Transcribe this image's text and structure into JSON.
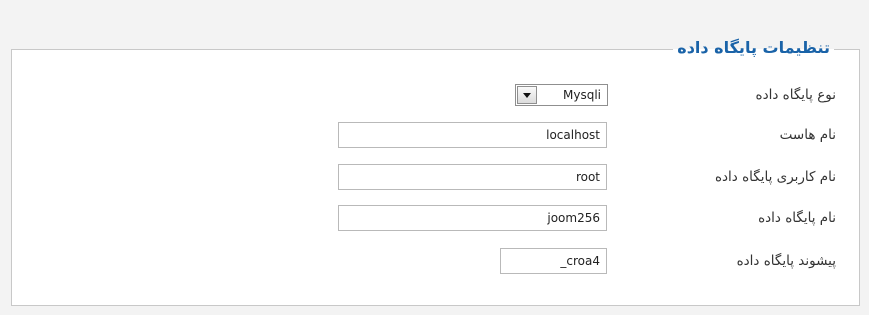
{
  "section": {
    "title": "تنظیمات پایگاه داده"
  },
  "fields": {
    "db_type": {
      "label": "نوع پایگاه داده",
      "value": "Mysqli"
    },
    "host": {
      "label": "نام هاست",
      "value": "localhost"
    },
    "username": {
      "label": "نام کاربری پایگاه داده",
      "value": "root"
    },
    "db_name": {
      "label": "نام پایگاه داده",
      "value": "joom256"
    },
    "prefix": {
      "label": "پیشوند پایگاه داده",
      "value": "_croa4"
    }
  }
}
